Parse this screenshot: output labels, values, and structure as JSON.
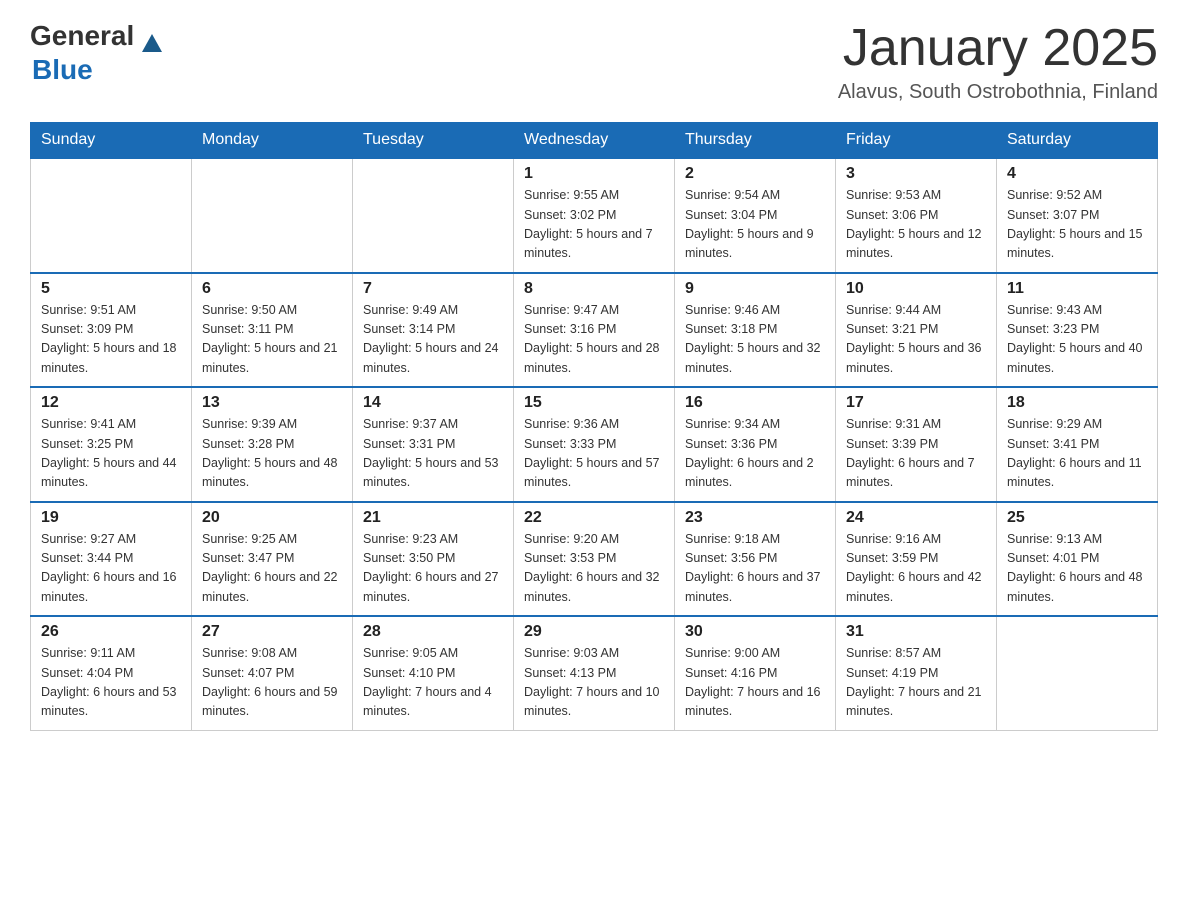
{
  "header": {
    "logo_general": "General",
    "logo_blue": "Blue",
    "month_title": "January 2025",
    "location": "Alavus, South Ostrobothnia, Finland"
  },
  "weekdays": [
    "Sunday",
    "Monday",
    "Tuesday",
    "Wednesday",
    "Thursday",
    "Friday",
    "Saturday"
  ],
  "weeks": [
    [
      {
        "day": "",
        "info": ""
      },
      {
        "day": "",
        "info": ""
      },
      {
        "day": "",
        "info": ""
      },
      {
        "day": "1",
        "info": "Sunrise: 9:55 AM\nSunset: 3:02 PM\nDaylight: 5 hours\nand 7 minutes."
      },
      {
        "day": "2",
        "info": "Sunrise: 9:54 AM\nSunset: 3:04 PM\nDaylight: 5 hours\nand 9 minutes."
      },
      {
        "day": "3",
        "info": "Sunrise: 9:53 AM\nSunset: 3:06 PM\nDaylight: 5 hours\nand 12 minutes."
      },
      {
        "day": "4",
        "info": "Sunrise: 9:52 AM\nSunset: 3:07 PM\nDaylight: 5 hours\nand 15 minutes."
      }
    ],
    [
      {
        "day": "5",
        "info": "Sunrise: 9:51 AM\nSunset: 3:09 PM\nDaylight: 5 hours\nand 18 minutes."
      },
      {
        "day": "6",
        "info": "Sunrise: 9:50 AM\nSunset: 3:11 PM\nDaylight: 5 hours\nand 21 minutes."
      },
      {
        "day": "7",
        "info": "Sunrise: 9:49 AM\nSunset: 3:14 PM\nDaylight: 5 hours\nand 24 minutes."
      },
      {
        "day": "8",
        "info": "Sunrise: 9:47 AM\nSunset: 3:16 PM\nDaylight: 5 hours\nand 28 minutes."
      },
      {
        "day": "9",
        "info": "Sunrise: 9:46 AM\nSunset: 3:18 PM\nDaylight: 5 hours\nand 32 minutes."
      },
      {
        "day": "10",
        "info": "Sunrise: 9:44 AM\nSunset: 3:21 PM\nDaylight: 5 hours\nand 36 minutes."
      },
      {
        "day": "11",
        "info": "Sunrise: 9:43 AM\nSunset: 3:23 PM\nDaylight: 5 hours\nand 40 minutes."
      }
    ],
    [
      {
        "day": "12",
        "info": "Sunrise: 9:41 AM\nSunset: 3:25 PM\nDaylight: 5 hours\nand 44 minutes."
      },
      {
        "day": "13",
        "info": "Sunrise: 9:39 AM\nSunset: 3:28 PM\nDaylight: 5 hours\nand 48 minutes."
      },
      {
        "day": "14",
        "info": "Sunrise: 9:37 AM\nSunset: 3:31 PM\nDaylight: 5 hours\nand 53 minutes."
      },
      {
        "day": "15",
        "info": "Sunrise: 9:36 AM\nSunset: 3:33 PM\nDaylight: 5 hours\nand 57 minutes."
      },
      {
        "day": "16",
        "info": "Sunrise: 9:34 AM\nSunset: 3:36 PM\nDaylight: 6 hours\nand 2 minutes."
      },
      {
        "day": "17",
        "info": "Sunrise: 9:31 AM\nSunset: 3:39 PM\nDaylight: 6 hours\nand 7 minutes."
      },
      {
        "day": "18",
        "info": "Sunrise: 9:29 AM\nSunset: 3:41 PM\nDaylight: 6 hours\nand 11 minutes."
      }
    ],
    [
      {
        "day": "19",
        "info": "Sunrise: 9:27 AM\nSunset: 3:44 PM\nDaylight: 6 hours\nand 16 minutes."
      },
      {
        "day": "20",
        "info": "Sunrise: 9:25 AM\nSunset: 3:47 PM\nDaylight: 6 hours\nand 22 minutes."
      },
      {
        "day": "21",
        "info": "Sunrise: 9:23 AM\nSunset: 3:50 PM\nDaylight: 6 hours\nand 27 minutes."
      },
      {
        "day": "22",
        "info": "Sunrise: 9:20 AM\nSunset: 3:53 PM\nDaylight: 6 hours\nand 32 minutes."
      },
      {
        "day": "23",
        "info": "Sunrise: 9:18 AM\nSunset: 3:56 PM\nDaylight: 6 hours\nand 37 minutes."
      },
      {
        "day": "24",
        "info": "Sunrise: 9:16 AM\nSunset: 3:59 PM\nDaylight: 6 hours\nand 42 minutes."
      },
      {
        "day": "25",
        "info": "Sunrise: 9:13 AM\nSunset: 4:01 PM\nDaylight: 6 hours\nand 48 minutes."
      }
    ],
    [
      {
        "day": "26",
        "info": "Sunrise: 9:11 AM\nSunset: 4:04 PM\nDaylight: 6 hours\nand 53 minutes."
      },
      {
        "day": "27",
        "info": "Sunrise: 9:08 AM\nSunset: 4:07 PM\nDaylight: 6 hours\nand 59 minutes."
      },
      {
        "day": "28",
        "info": "Sunrise: 9:05 AM\nSunset: 4:10 PM\nDaylight: 7 hours\nand 4 minutes."
      },
      {
        "day": "29",
        "info": "Sunrise: 9:03 AM\nSunset: 4:13 PM\nDaylight: 7 hours\nand 10 minutes."
      },
      {
        "day": "30",
        "info": "Sunrise: 9:00 AM\nSunset: 4:16 PM\nDaylight: 7 hours\nand 16 minutes."
      },
      {
        "day": "31",
        "info": "Sunrise: 8:57 AM\nSunset: 4:19 PM\nDaylight: 7 hours\nand 21 minutes."
      },
      {
        "day": "",
        "info": ""
      }
    ]
  ]
}
